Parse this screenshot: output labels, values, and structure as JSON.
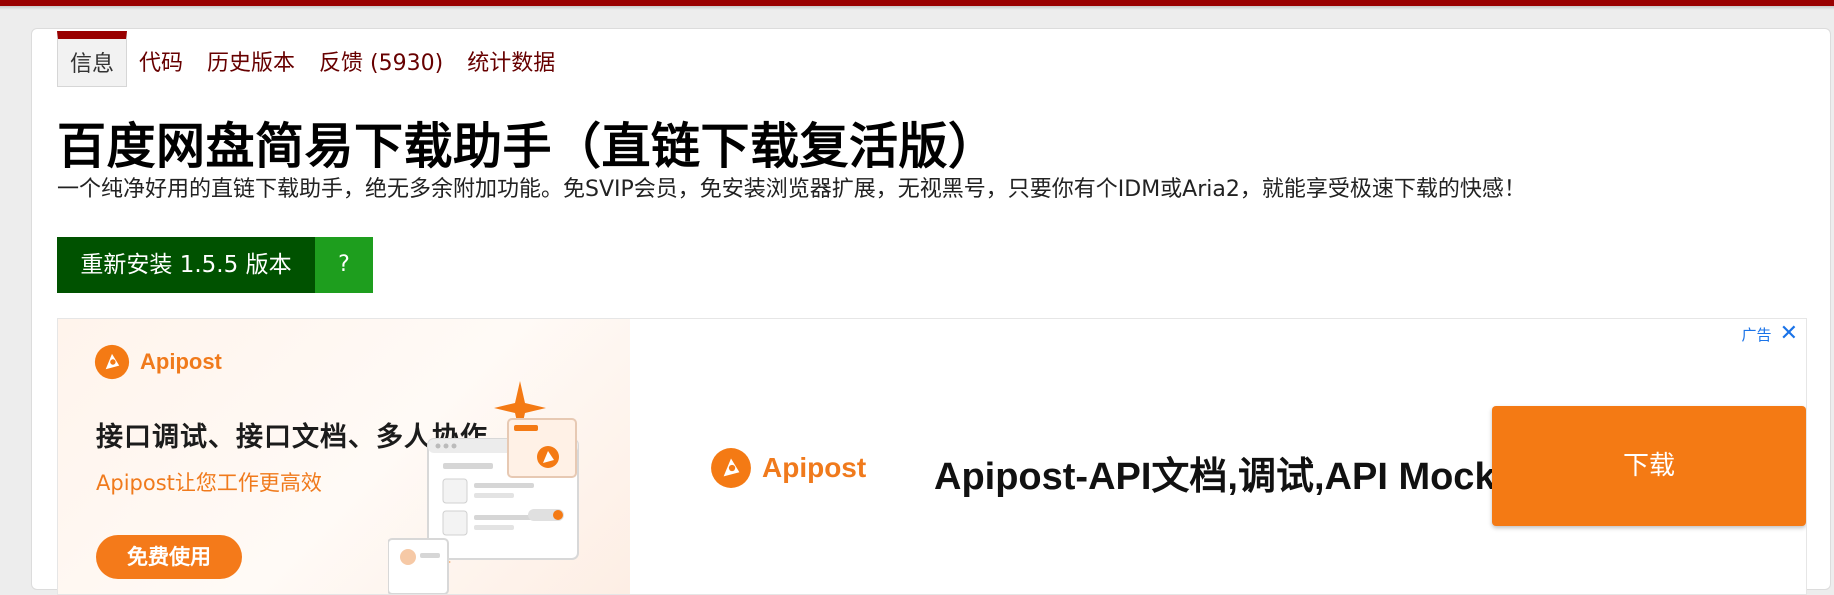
{
  "tabs": [
    {
      "label": "信息"
    },
    {
      "label": "代码"
    },
    {
      "label": "历史版本"
    },
    {
      "label": "反馈 (5930)"
    },
    {
      "label": "统计数据"
    }
  ],
  "script": {
    "title": "百度网盘简易下载助手（直链下载复活版）",
    "description": "一个纯净好用的直链下载助手，绝无多余附加功能。免SVIP会员，免安装浏览器扩展，无视黑号，只要你有个IDM或Aria2，就能享受极速下载的快感！"
  },
  "install": {
    "button_label": "重新安装 1.5.5 版本",
    "help_label": "?"
  },
  "ad": {
    "brand": "Apipost",
    "headline": "接口调试、接口文档、多人协作",
    "subhead": "Apipost让您工作更高效",
    "cta_free": "免费使用",
    "title": "Apipost-API文档,调试,API Mock",
    "download_label": "下载",
    "ad_label": "广告",
    "close_glyph": "✕"
  },
  "colors": {
    "tab_active_border": "#990000",
    "link": "#670000",
    "install_bg": "#005200",
    "install_help_bg": "#1e9e1e",
    "ad_accent": "#f47a14"
  }
}
